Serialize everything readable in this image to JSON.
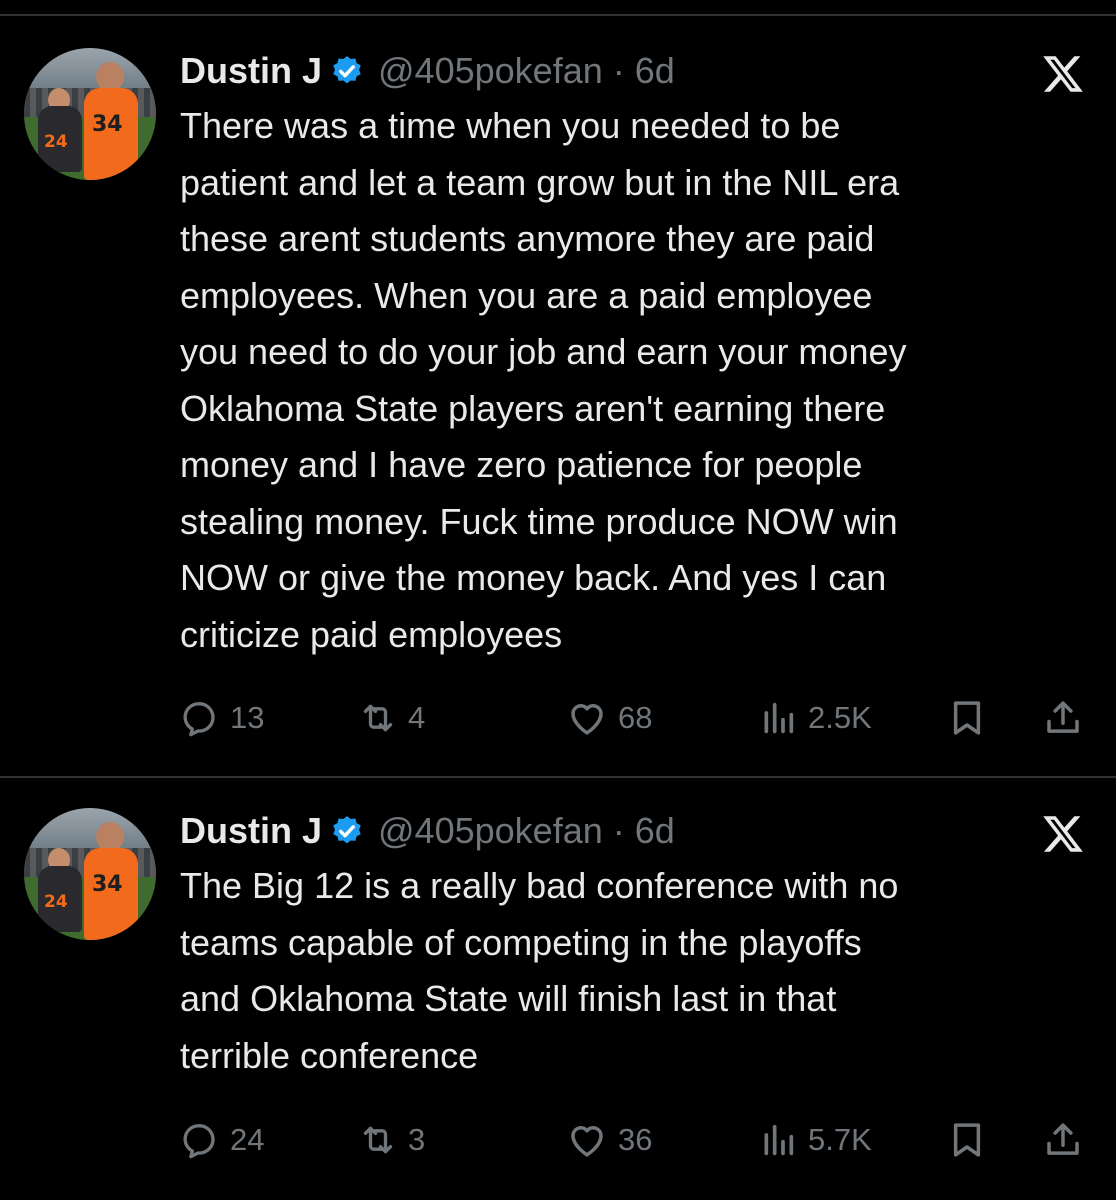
{
  "colors": {
    "background": "#000000",
    "text": "#e7e9ea",
    "secondary": "#71767b",
    "verified": "#1d9bf0",
    "divider": "#2f3336"
  },
  "icons": [
    "reply-icon",
    "retweet-icon",
    "like-icon",
    "views-icon",
    "bookmark-icon",
    "share-icon",
    "x-logo-icon",
    "verified-badge-icon"
  ],
  "tweets": [
    {
      "author": "Dustin J",
      "handle": "@405pokefan · 6d",
      "lines": [
        "There was a time when you needed to be",
        "patient and let a team grow but in the NIL era",
        "these arent students anymore they are paid",
        "employees. When you are a paid employee",
        "you need to do your job and earn your money",
        "Oklahoma State players aren't earning there",
        "money and I have zero patience for people",
        "stealing money. Fuck time produce NOW win",
        "NOW or give the money back. And yes I can",
        "criticize paid employees"
      ],
      "stats": {
        "replies": "13",
        "reposts": "4",
        "likes": "68",
        "views": "2.5K"
      }
    },
    {
      "author": "Dustin J",
      "handle": "@405pokefan · 6d",
      "lines": [
        "The Big 12 is a really bad conference with no",
        "teams capable of competing in the playoffs",
        "and Oklahoma State will finish last in that",
        "terrible conference"
      ],
      "stats": {
        "replies": "24",
        "reposts": "3",
        "likes": "36",
        "views": "5.7K"
      }
    }
  ]
}
